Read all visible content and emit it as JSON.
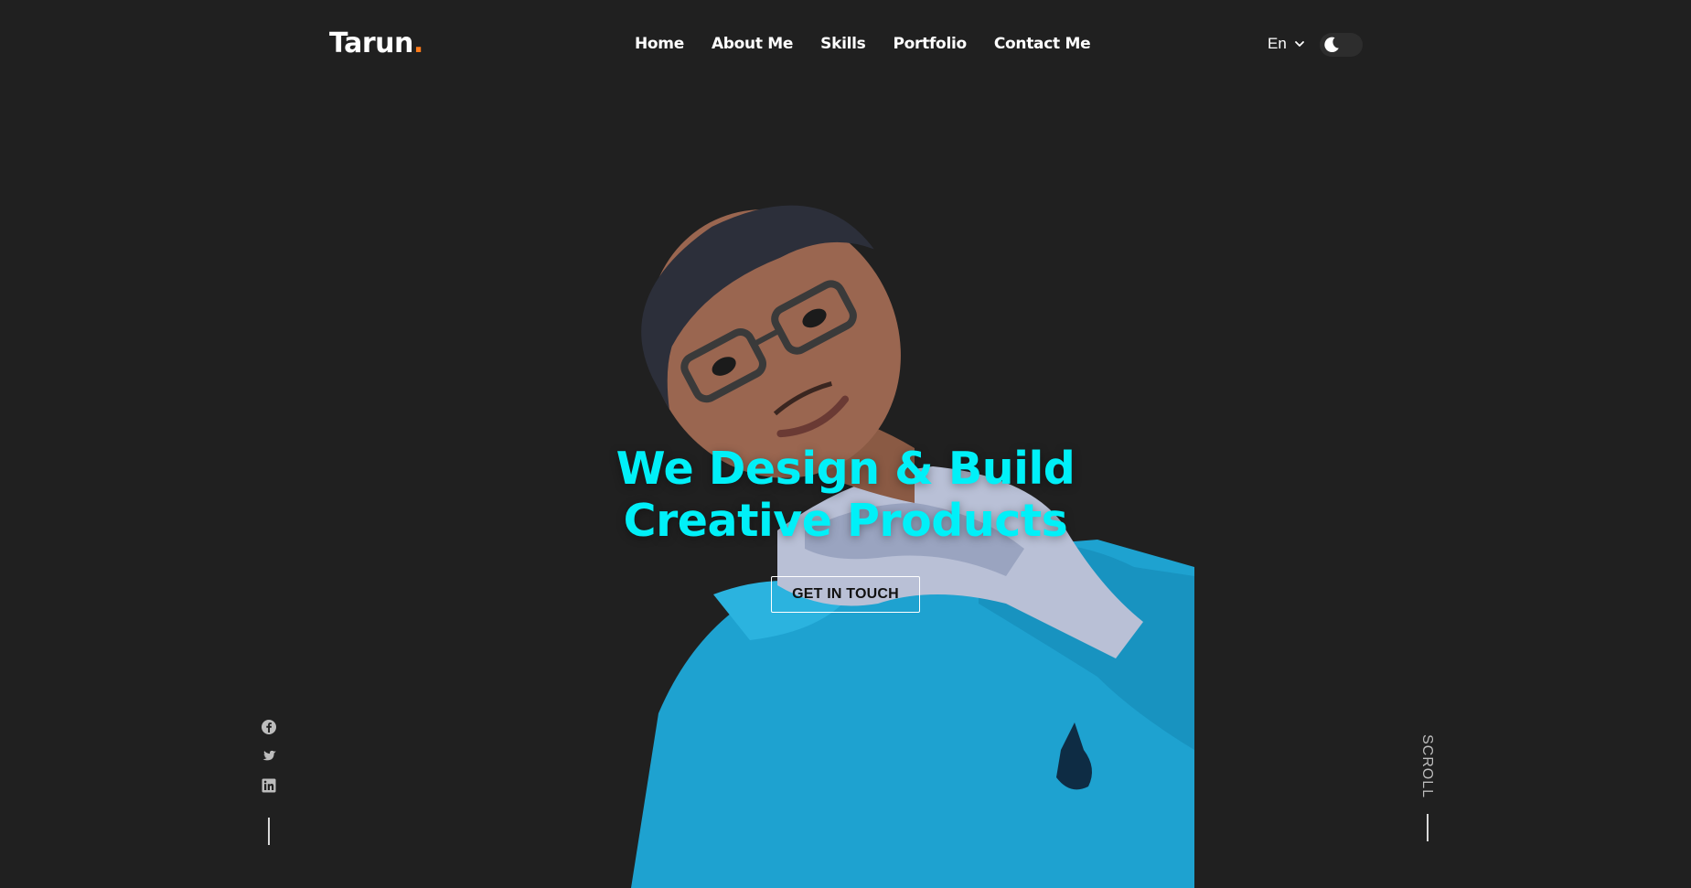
{
  "brand": {
    "name": "Tarun",
    "dot": ".",
    "accent_color": "#ff7a1a"
  },
  "nav": {
    "items": [
      {
        "label": "Home"
      },
      {
        "label": "About Me"
      },
      {
        "label": "Skills"
      },
      {
        "label": "Portfolio"
      },
      {
        "label": "Contact Me"
      }
    ]
  },
  "header": {
    "language": "En",
    "language_icon": "chevron-down-icon",
    "theme_toggle_icon": "moon-icon"
  },
  "hero": {
    "headline_line1": "We Design & Build",
    "headline_line2": "Creative Products",
    "headline_color": "#00f0f8",
    "cta_label": "GET IN TOUCH",
    "photo_icon": "profile-photo"
  },
  "social": {
    "items": [
      {
        "icon": "facebook-icon"
      },
      {
        "icon": "twitter-icon"
      },
      {
        "icon": "linkedin-icon"
      }
    ]
  },
  "scroll": {
    "label": "SCROLL"
  },
  "colors": {
    "background": "#202020",
    "shirt": "#1ea2d0",
    "text": "#ffffff"
  }
}
